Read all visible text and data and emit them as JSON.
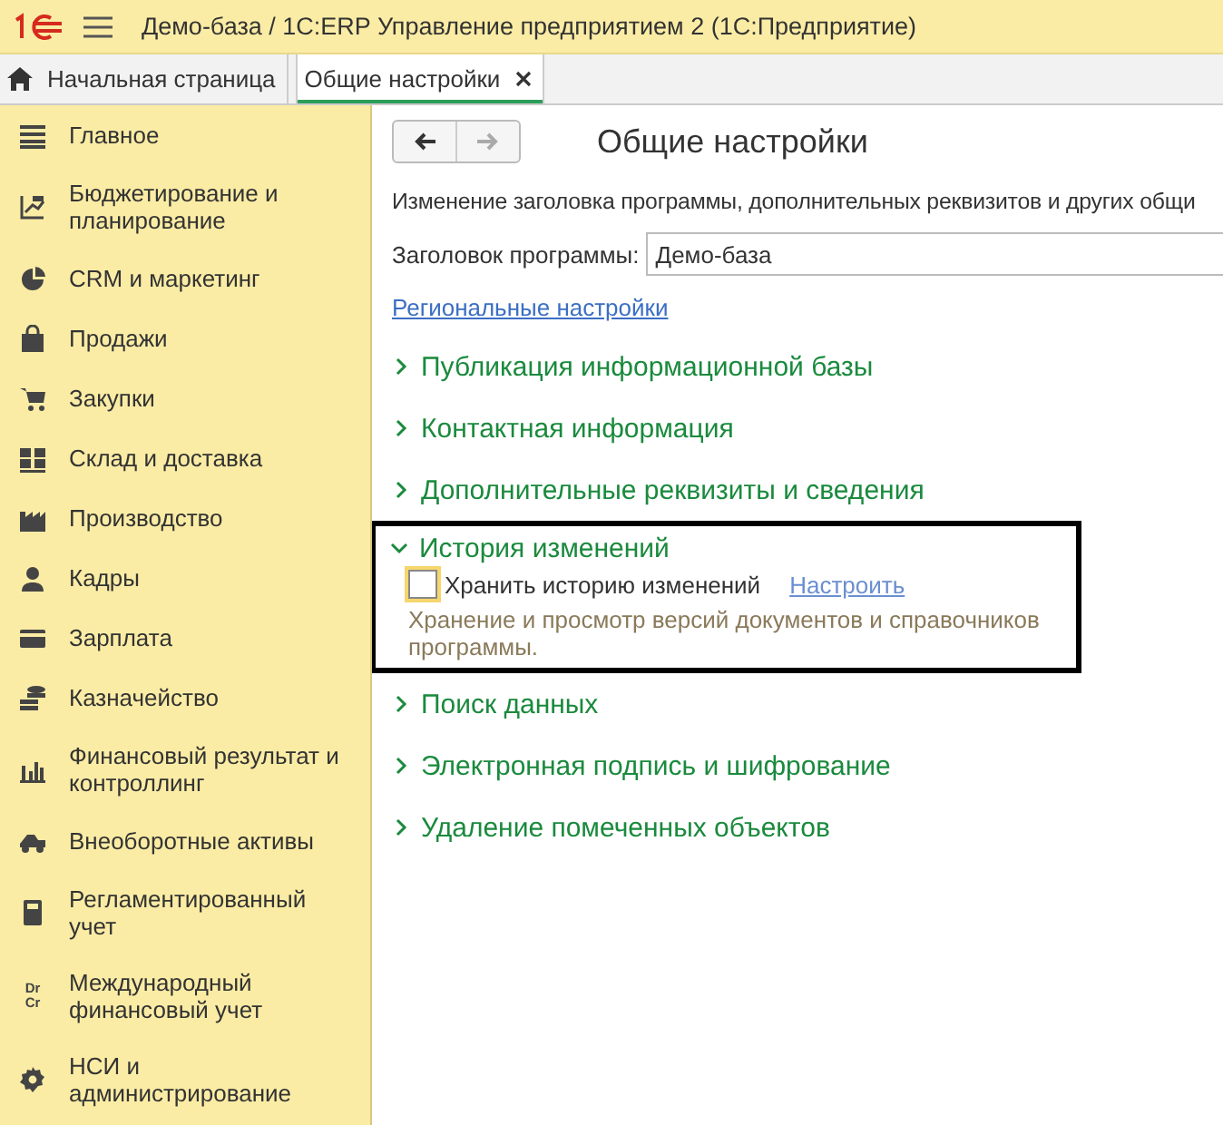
{
  "window": {
    "title": "Демо-база / 1С:ERP Управление предприятием 2  (1С:Предприятие)"
  },
  "tabs": [
    {
      "label": "Начальная страница",
      "selected": false,
      "kind": "home"
    },
    {
      "label": "Общие настройки",
      "selected": true,
      "kind": "closable"
    }
  ],
  "sidebar": {
    "items": [
      {
        "label": "Главное"
      },
      {
        "label": "Бюджетирование и планирование"
      },
      {
        "label": "CRM и маркетинг"
      },
      {
        "label": "Продажи"
      },
      {
        "label": "Закупки"
      },
      {
        "label": "Склад и доставка"
      },
      {
        "label": "Производство"
      },
      {
        "label": "Кадры"
      },
      {
        "label": "Зарплата"
      },
      {
        "label": "Казначейство"
      },
      {
        "label": "Финансовый результат и контроллинг"
      },
      {
        "label": "Внеоборотные активы"
      },
      {
        "label": "Регламентированный учет"
      },
      {
        "label": "Международный финансовый учет",
        "icon_text": [
          "Dr",
          "Cr"
        ]
      },
      {
        "label": "НСИ и администрирование"
      }
    ]
  },
  "page": {
    "title": "Общие настройки",
    "description": "Изменение заголовка программы, дополнительных реквизитов и других общи",
    "title_field": {
      "label": "Заголовок программы:",
      "value": "Демо-база"
    },
    "link": "Региональные настройки",
    "sections": [
      {
        "title": "Публикация информационной базы",
        "expanded": false,
        "highlighted": false
      },
      {
        "title": "Контактная информация",
        "expanded": false,
        "highlighted": false
      },
      {
        "title": "Дополнительные реквизиты и сведения",
        "expanded": false,
        "highlighted": false
      },
      {
        "title": "История изменений",
        "expanded": true,
        "highlighted": true,
        "option": {
          "label": "Хранить историю изменений",
          "checked": false,
          "link": "Настроить",
          "note": "Хранение и просмотр версий документов и справочников программы."
        }
      },
      {
        "title": "Поиск данных",
        "expanded": false,
        "highlighted": false
      },
      {
        "title": "Электронная подпись и шифрование",
        "expanded": false,
        "highlighted": false
      },
      {
        "title": "Удаление помеченных объектов",
        "expanded": false,
        "highlighted": false
      }
    ]
  }
}
